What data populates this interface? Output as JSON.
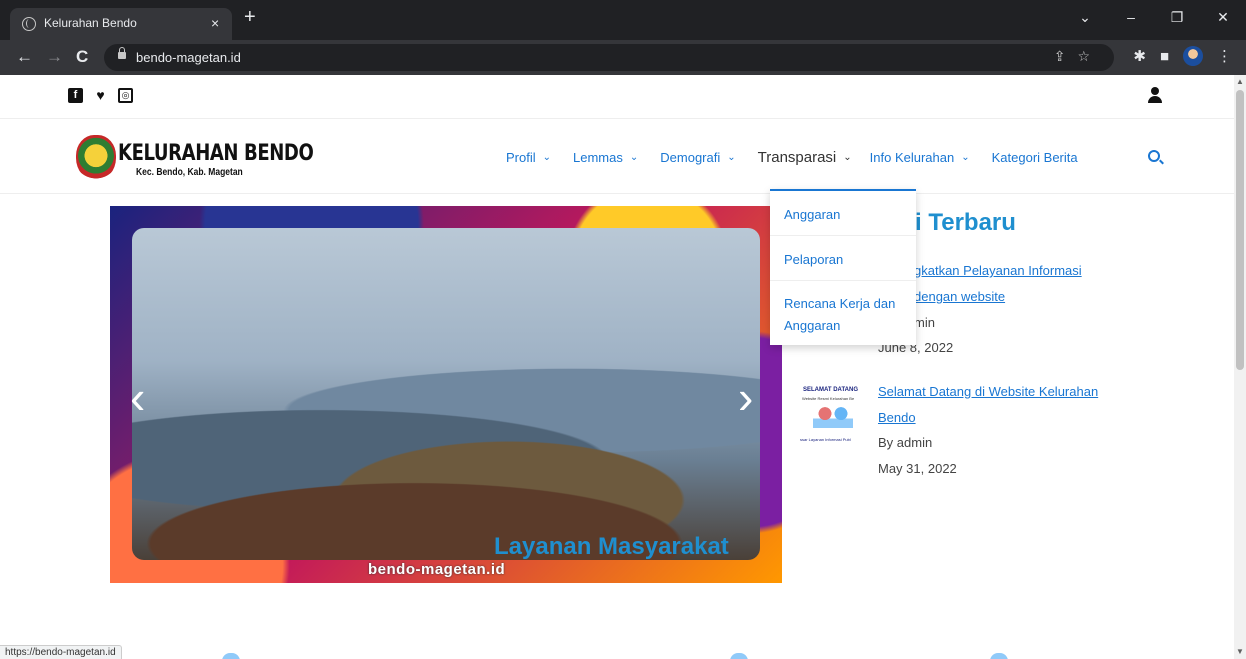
{
  "browser": {
    "tab_title": "Kelurahan Bendo",
    "tab_close": "×",
    "new_tab": "+",
    "url": "bendo-magetan.id",
    "status_url": "https://bendo-magetan.id",
    "window_controls": [
      "⌄",
      "–",
      "❐",
      "✕"
    ]
  },
  "site": {
    "logo_title": "KELURAHAN BENDO",
    "logo_subtitle": "Kec. Bendo, Kab. Magetan",
    "social": [
      "facebook-icon",
      "twitter-icon",
      "instagram-icon"
    ],
    "menu": [
      {
        "label": "Profil"
      },
      {
        "label": "Lemmas"
      },
      {
        "label": "Demografi"
      },
      {
        "label": "Transparasi"
      },
      {
        "label": "Info Kelurahan"
      },
      {
        "label": "Kategori Berita"
      }
    ],
    "dropdown": [
      "Anggaran",
      "Pelaporan",
      "Rencana Kerja dan Anggaran"
    ],
    "slider_caption": "bendo-magetan.id",
    "news_section_title": "i Terbaru",
    "news": [
      {
        "title_line1": "gkatkan Pelayanan Informasi",
        "title_line2": "dengan website",
        "author": "min",
        "date": "June 8, 2022"
      },
      {
        "title_line1": "Selamat Datang di Website Kelurahan",
        "title_line2": "Bendo",
        "author": "By admin",
        "date": "May 31, 2022",
        "thumb_text1": "SELAMAT DATANG",
        "thumb_text2": "Website Resmi Kelurahan Be",
        "thumb_text3": "ssar Layanan Informasi Publ"
      }
    ],
    "services_title": "Layanan Masyarakat"
  }
}
